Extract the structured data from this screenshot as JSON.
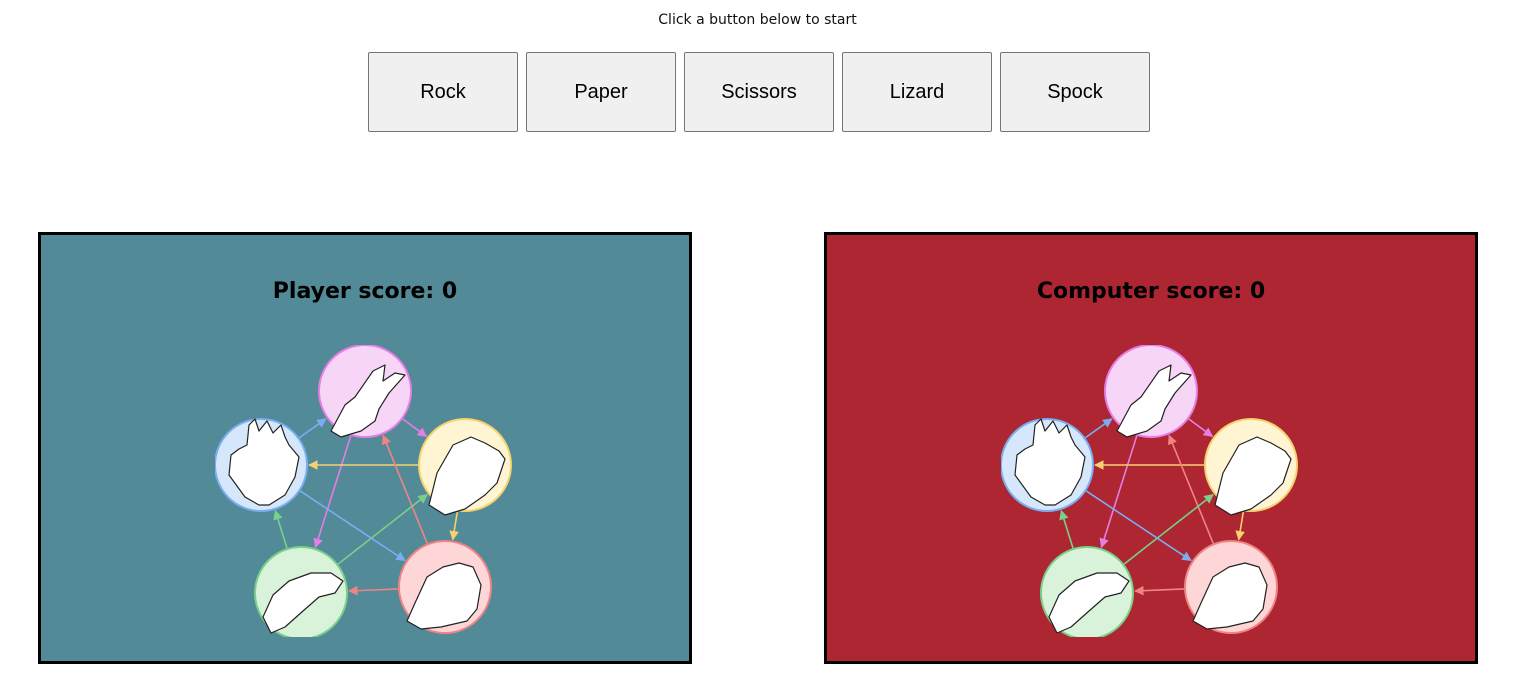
{
  "instruction": "Click a button below to start",
  "buttons": [
    {
      "label": "Rock"
    },
    {
      "label": "Paper"
    },
    {
      "label": "Scissors"
    },
    {
      "label": "Lizard"
    },
    {
      "label": "Spock"
    }
  ],
  "player": {
    "score_text": "Player score: 0",
    "background": "#528a98"
  },
  "computer": {
    "score_text": "Computer score: 0",
    "background": "#ae2631"
  },
  "diagram": {
    "nodes": [
      {
        "icon": "scissors-hand-icon",
        "fill": "#f7d5f7",
        "stroke": "#e57ee5"
      },
      {
        "icon": "paper-hand-icon",
        "fill": "#fff5d2",
        "stroke": "#f5d26e"
      },
      {
        "icon": "rock-hand-icon",
        "fill": "#fed6d7",
        "stroke": "#f08485"
      },
      {
        "icon": "lizard-hand-icon",
        "fill": "#d8f3da",
        "stroke": "#79d089"
      },
      {
        "icon": "spock-hand-icon",
        "fill": "#d6e6fb",
        "stroke": "#79aef0"
      }
    ]
  }
}
